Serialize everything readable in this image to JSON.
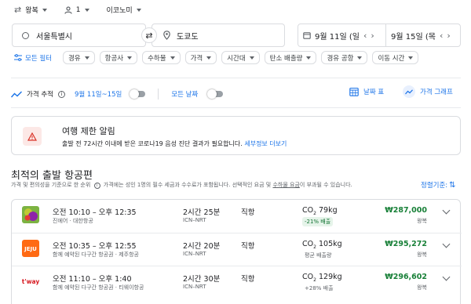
{
  "top": {
    "trip_type": "왕복",
    "passengers": "1",
    "cabin": "이코노미"
  },
  "search": {
    "from": "서울특별시",
    "to": "도쿄도",
    "depart_date": "9월 11일 (일",
    "return_date": "9월 15일 (목"
  },
  "filters": {
    "all_label": "모든 필터",
    "chips": [
      "경유",
      "항공사",
      "수하물",
      "가격",
      "시간대",
      "탄소 배출량",
      "경유 공항",
      "이동 시간"
    ]
  },
  "tracking": {
    "label": "가격 추적",
    "dates": "9월 11일~15일",
    "all_dates": "모든 날짜",
    "date_grid": "날짜 표",
    "price_graph": "가격 그래프"
  },
  "alert": {
    "title": "여행 제한 알림",
    "body": "출발 전 72시간 이내에 받은 코로나19 음성 진단 결과가 필요합니다.",
    "link": "세부정보 더보기"
  },
  "results": {
    "heading": "최적의 출발 항공편",
    "sub1": "가격 및 편의성을 기준으로 한 순위",
    "sub2": "가격에는 성인 1명의 필수 세금과 수수료가 포함됩니다. 선택적인 요금 및",
    "sub2_link": "수하물 요금",
    "sub2_end": "이 부과될 수 있습니다.",
    "sort_label": "정렬기준:",
    "flights": [
      {
        "time": "오전 10:10 – 오후 12:35",
        "airline": "진에어 · 대한항공",
        "duration": "2시간 25분",
        "route": "ICN–NRT",
        "stops": "직항",
        "co2_prefix": "CO",
        "co2_sub": "2",
        "co2_val": "79kg",
        "emission": "-21% 배출",
        "price": "₩287,000",
        "trip": "왕복",
        "logo_bg": "#7cb342"
      },
      {
        "time": "오전 10:35 – 오후 12:55",
        "airline": "함께 예약된 다구간 항공권 · 제주항공",
        "duration": "2시간 20분",
        "route": "ICN–NRT",
        "stops": "직항",
        "co2_prefix": "CO",
        "co2_sub": "2",
        "co2_val": "105kg",
        "emission": "평균 배출량",
        "price": "₩295,272",
        "trip": "왕복",
        "logo_bg": "#ff6a13"
      },
      {
        "time": "오전 11:10 – 오후 1:40",
        "airline": "함께 예약된 다구간 항공권 · 티웨이항공",
        "duration": "2시간 30분",
        "route": "ICN–NRT",
        "stops": "직항",
        "co2_prefix": "CO",
        "co2_sub": "2",
        "co2_val": "129kg",
        "emission": "+28% 배출",
        "price": "₩296,602",
        "trip": "왕복",
        "logo_bg": "#ffffff"
      }
    ]
  }
}
